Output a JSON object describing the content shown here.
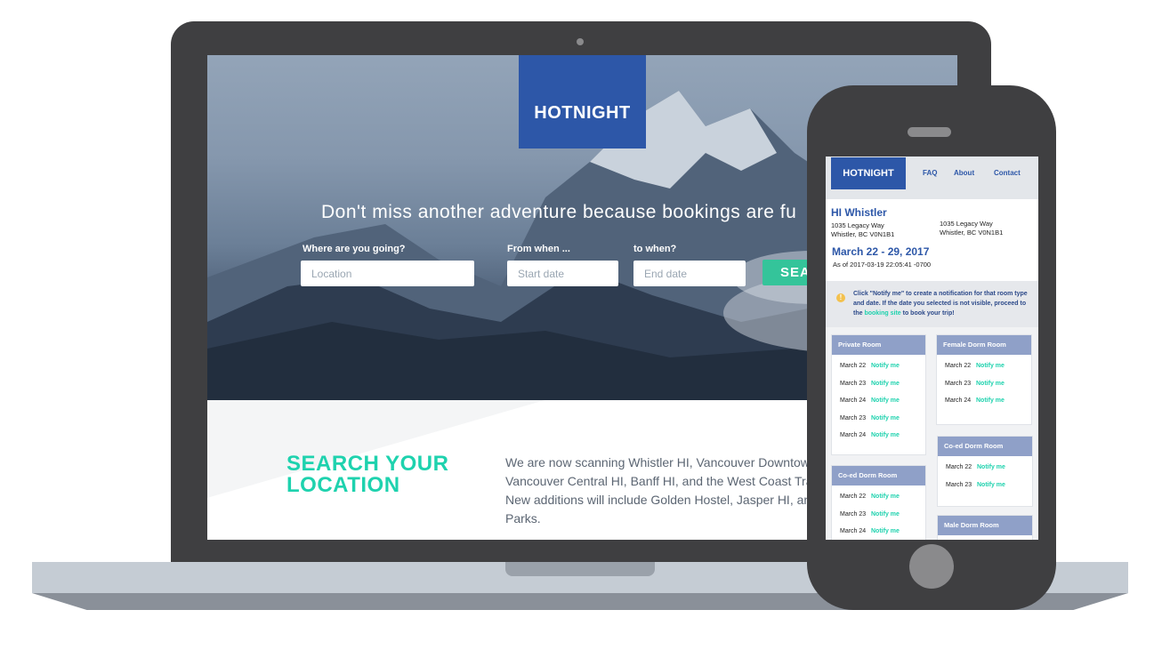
{
  "site": {
    "logo": "HOTNIGHT",
    "headline": "Don't miss another adventure because bookings are fu",
    "search": {
      "location_label": "Where are you going?",
      "location_placeholder": "Location",
      "from_label": "From when ...",
      "start_placeholder": "Start date",
      "to_label": "to when?",
      "end_placeholder": "End date",
      "button_label": "SEA"
    },
    "info": {
      "title_line1": "SEARCH YOUR",
      "title_line2": "LOCATION",
      "para_line1": "We are now scanning Whistler HI, Vancouver Downtown",
      "para_line2": "Vancouver Central HI, Banff HI, and the West Coast Tra",
      "para_line3": "New additions will include Golden Hostel, Jasper HI, an",
      "para_line4": "Parks."
    }
  },
  "phone": {
    "logo": "HOTNIGHT",
    "nav": [
      "FAQ",
      "About",
      "Contact"
    ],
    "hostel": {
      "name": "HI Whistler",
      "addr_left_1": "1035 Legacy Way",
      "addr_left_2": "Whistler, BC V0N1B1",
      "addr_right_1": "1035 Legacy Way",
      "addr_right_2": "Whistler, BC V0N1B1",
      "dates": "March 22 - 29, 2017",
      "as_of": "As of 2017-03-19 22:05:41 -0700"
    },
    "notice": {
      "part1": "Click \"Notify me\" to create a notification for that room type and date. If the date you selected is not visible, proceed to the ",
      "link": "booking site",
      "part2": " to book your trip!"
    },
    "notify_label": "Notify me",
    "rooms": {
      "private": {
        "title": "Private Room",
        "dates": [
          "March 22",
          "March 23",
          "March 24",
          "March 23",
          "March 24"
        ]
      },
      "female": {
        "title": "Female Dorm Room",
        "dates": [
          "March 22",
          "March 23",
          "March 24"
        ]
      },
      "coed_left": {
        "title": "Co-ed Dorm Room",
        "dates": [
          "March 22",
          "March 23",
          "March 24"
        ]
      },
      "coed_right": {
        "title": "Co-ed Dorm Room",
        "dates": [
          "March 22",
          "March 23"
        ]
      },
      "male": {
        "title": "Male Dorm Room",
        "dates": []
      }
    }
  },
  "colors": {
    "brand_blue": "#2d57a8",
    "accent_teal": "#1ed2ae",
    "search_green": "#34c49a",
    "device_dark": "#3f3f41"
  }
}
